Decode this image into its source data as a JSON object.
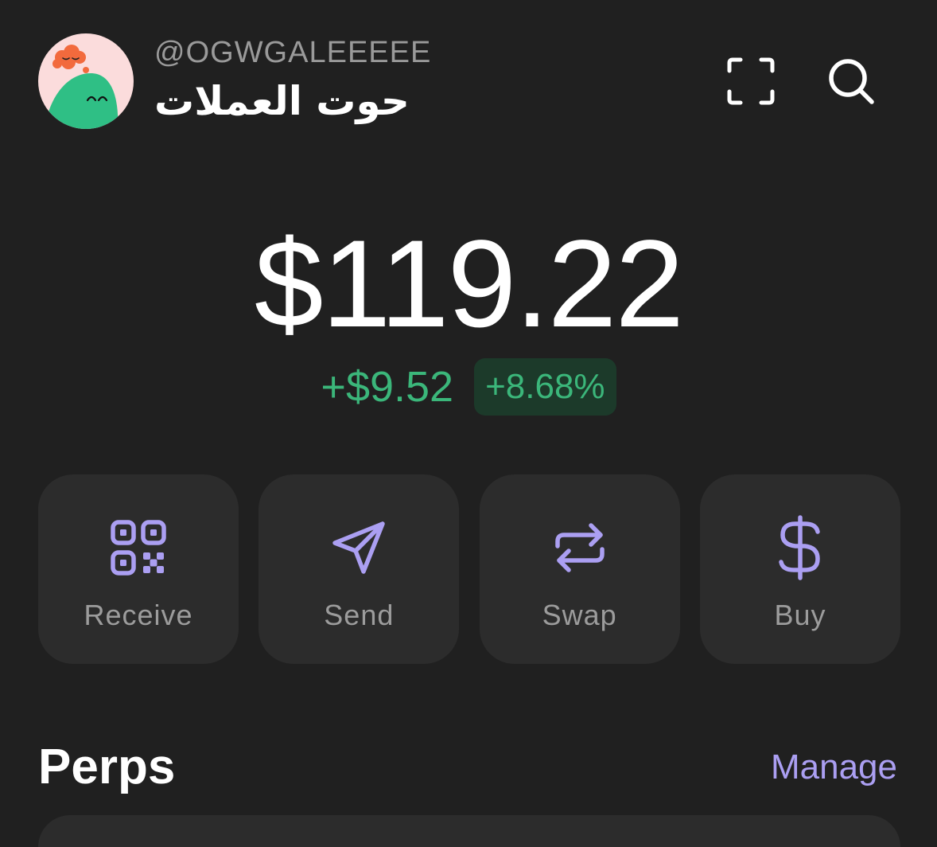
{
  "header": {
    "handle": "@OGWGALEEEEE",
    "display_name": "حوت العملات"
  },
  "icons": {
    "avatar": "avatar-illustration",
    "scan": "scan-icon",
    "search": "search-icon"
  },
  "balance": {
    "total": "$119.22",
    "change_amount": "+$9.52",
    "change_percent": "+8.68%"
  },
  "actions": [
    {
      "label": "Receive",
      "icon": "qr-code-icon"
    },
    {
      "label": "Send",
      "icon": "send-icon"
    },
    {
      "label": "Swap",
      "icon": "swap-icon"
    },
    {
      "label": "Buy",
      "icon": "dollar-icon"
    }
  ],
  "perps": {
    "title": "Perps",
    "manage_label": "Manage"
  },
  "colors": {
    "background": "#202020",
    "card": "#2c2c2c",
    "positive": "#3bb67a",
    "positive_bg": "#1c3a2a",
    "accent": "#ab9ff2",
    "muted_text": "#9c9c9c"
  }
}
